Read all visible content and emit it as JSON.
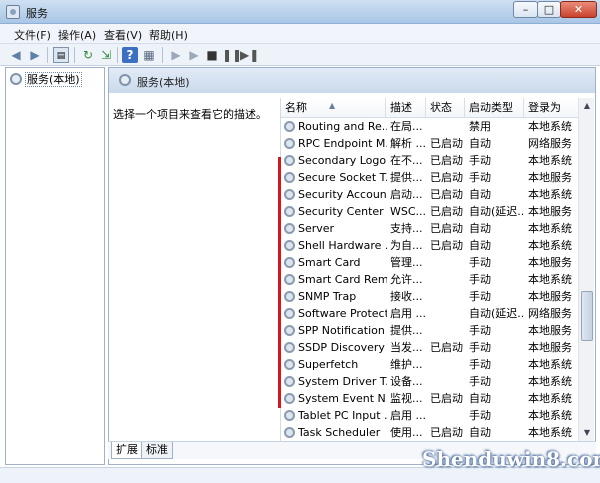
{
  "window": {
    "title": "服务"
  },
  "window_controls": {
    "minimize": "–",
    "maximize": "□",
    "close": "✕"
  },
  "menu": [
    {
      "label": "文件(F)"
    },
    {
      "label": "操作(A)"
    },
    {
      "label": "查看(V)"
    },
    {
      "label": "帮助(H)"
    }
  ],
  "toolbar": {
    "icons": [
      "back-icon",
      "forward-icon",
      "show-hide-tree-icon",
      "refresh-icon",
      "export-list-icon",
      "help-icon",
      "properties-icon",
      "start-icon",
      "stop-icon",
      "pause-icon",
      "restart-icon"
    ]
  },
  "tree": {
    "root_label": "服务(本地)"
  },
  "main": {
    "header_title": "服务(本地)",
    "description_prompt": "选择一个项目来查看它的描述。",
    "columns": [
      "名称",
      "描述",
      "状态",
      "启动类型",
      "登录为"
    ],
    "rows": [
      {
        "name": "Routing and Re...",
        "desc": "在局...",
        "status": "",
        "startup": "禁用",
        "logon": "本地系统"
      },
      {
        "name": "RPC Endpoint M...",
        "desc": "解析 ...",
        "status": "已启动",
        "startup": "自动",
        "logon": "网络服务"
      },
      {
        "name": "Secondary Logon",
        "desc": "在不...",
        "status": "已启动",
        "startup": "手动",
        "logon": "本地系统"
      },
      {
        "name": "Secure Socket T...",
        "desc": "提供...",
        "status": "已启动",
        "startup": "手动",
        "logon": "本地服务"
      },
      {
        "name": "Security Account...",
        "desc": "启动...",
        "status": "已启动",
        "startup": "自动",
        "logon": "本地系统"
      },
      {
        "name": "Security Center",
        "desc": "WSC...",
        "status": "已启动",
        "startup": "自动(延迟...",
        "logon": "本地服务"
      },
      {
        "name": "Server",
        "desc": "支持...",
        "status": "已启动",
        "startup": "自动",
        "logon": "本地系统"
      },
      {
        "name": "Shell Hardware ...",
        "desc": "为自...",
        "status": "已启动",
        "startup": "自动",
        "logon": "本地系统"
      },
      {
        "name": "Smart Card",
        "desc": "管理...",
        "status": "",
        "startup": "手动",
        "logon": "本地服务"
      },
      {
        "name": "Smart Card Rem...",
        "desc": "允许...",
        "status": "",
        "startup": "手动",
        "logon": "本地系统"
      },
      {
        "name": "SNMP Trap",
        "desc": "接收...",
        "status": "",
        "startup": "手动",
        "logon": "本地服务"
      },
      {
        "name": "Software Protect...",
        "desc": "启用 ...",
        "status": "",
        "startup": "自动(延迟...",
        "logon": "网络服务"
      },
      {
        "name": "SPP Notification ...",
        "desc": "提供...",
        "status": "",
        "startup": "手动",
        "logon": "本地服务"
      },
      {
        "name": "SSDP Discovery",
        "desc": "当发...",
        "status": "已启动",
        "startup": "手动",
        "logon": "本地服务"
      },
      {
        "name": "Superfetch",
        "desc": "维护...",
        "status": "",
        "startup": "手动",
        "logon": "本地系统"
      },
      {
        "name": "System Driver T...",
        "desc": "设备...",
        "status": "",
        "startup": "手动",
        "logon": "本地系统"
      },
      {
        "name": "System Event N...",
        "desc": "监视...",
        "status": "已启动",
        "startup": "自动",
        "logon": "本地系统"
      },
      {
        "name": "Tablet PC Input ...",
        "desc": "启用 ...",
        "status": "",
        "startup": "手动",
        "logon": "本地系统"
      },
      {
        "name": "Task Scheduler",
        "desc": "使用...",
        "status": "已启动",
        "startup": "自动",
        "logon": "本地系统"
      }
    ]
  },
  "tabs": [
    {
      "label": "扩展"
    },
    {
      "label": "标准"
    }
  ],
  "watermark": "Shenduwin8.com",
  "colors": {
    "highlight_mark": "#d8151b",
    "titlebar": "#a9c6e6"
  }
}
